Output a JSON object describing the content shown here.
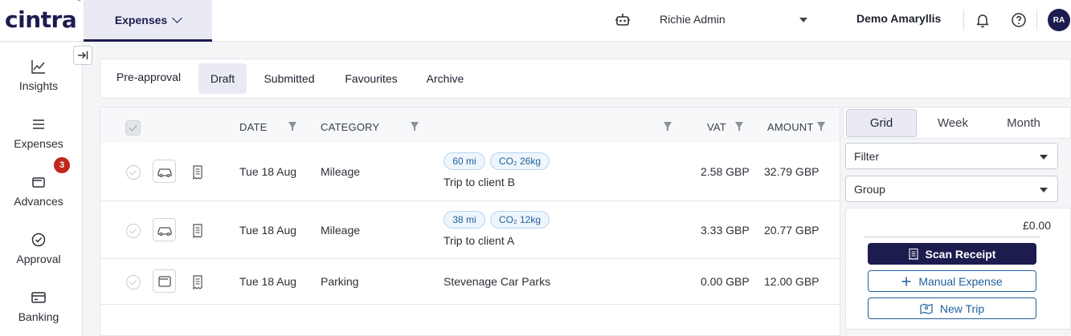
{
  "header": {
    "logo": "cintra",
    "logo_mark": "™",
    "module_tab": "Expenses",
    "user": "Richie Admin",
    "company": "Demo Amaryllis",
    "avatar": "RA"
  },
  "sidebar": {
    "items": [
      {
        "label": "Insights",
        "icon": "insights-chart-icon"
      },
      {
        "label": "Expenses",
        "icon": "menu-lines-icon",
        "badge": "3"
      },
      {
        "label": "Advances",
        "icon": "wallet-icon"
      },
      {
        "label": "Approval",
        "icon": "check-circle-icon"
      },
      {
        "label": "Banking",
        "icon": "bank-card-icon"
      }
    ]
  },
  "tabs": [
    "Pre-approval",
    "Draft",
    "Submitted",
    "Favourites",
    "Archive"
  ],
  "active_tab": "Draft",
  "grid": {
    "columns": [
      "DATE",
      "CATEGORY",
      "VAT",
      "AMOUNT"
    ],
    "rows": [
      {
        "type_icon": "car-icon",
        "date": "Tue 18 Aug",
        "category": "Mileage",
        "distance": "60 mi",
        "co2": "CO₂ 26kg",
        "description": "Trip to client B",
        "vat": "2.58 GBP",
        "amount": "32.79 GBP"
      },
      {
        "type_icon": "car-icon",
        "date": "Tue 18 Aug",
        "category": "Mileage",
        "distance": "38 mi",
        "co2": "CO₂ 12kg",
        "description": "Trip to client A",
        "vat": "3.33 GBP",
        "amount": "20.77 GBP"
      },
      {
        "type_icon": "wallet-icon",
        "date": "Tue 18 Aug",
        "category": "Parking",
        "distance": "",
        "co2": "",
        "description": "Stevenage Car Parks",
        "vat": "0.00 GBP",
        "amount": "12.00 GBP"
      }
    ]
  },
  "view": {
    "options": [
      "Grid",
      "Week",
      "Month"
    ],
    "active": "Grid"
  },
  "filter_label": "Filter",
  "group_label": "Group",
  "total": "£0.00",
  "actions": {
    "scan": "Scan Receipt",
    "manual": "Manual Expense",
    "trip": "New Trip"
  },
  "colors": {
    "brand": "#1d1c4f",
    "active_bg": "#e9eaf4",
    "badge": "#c0271d",
    "link": "#1f5f9c"
  }
}
